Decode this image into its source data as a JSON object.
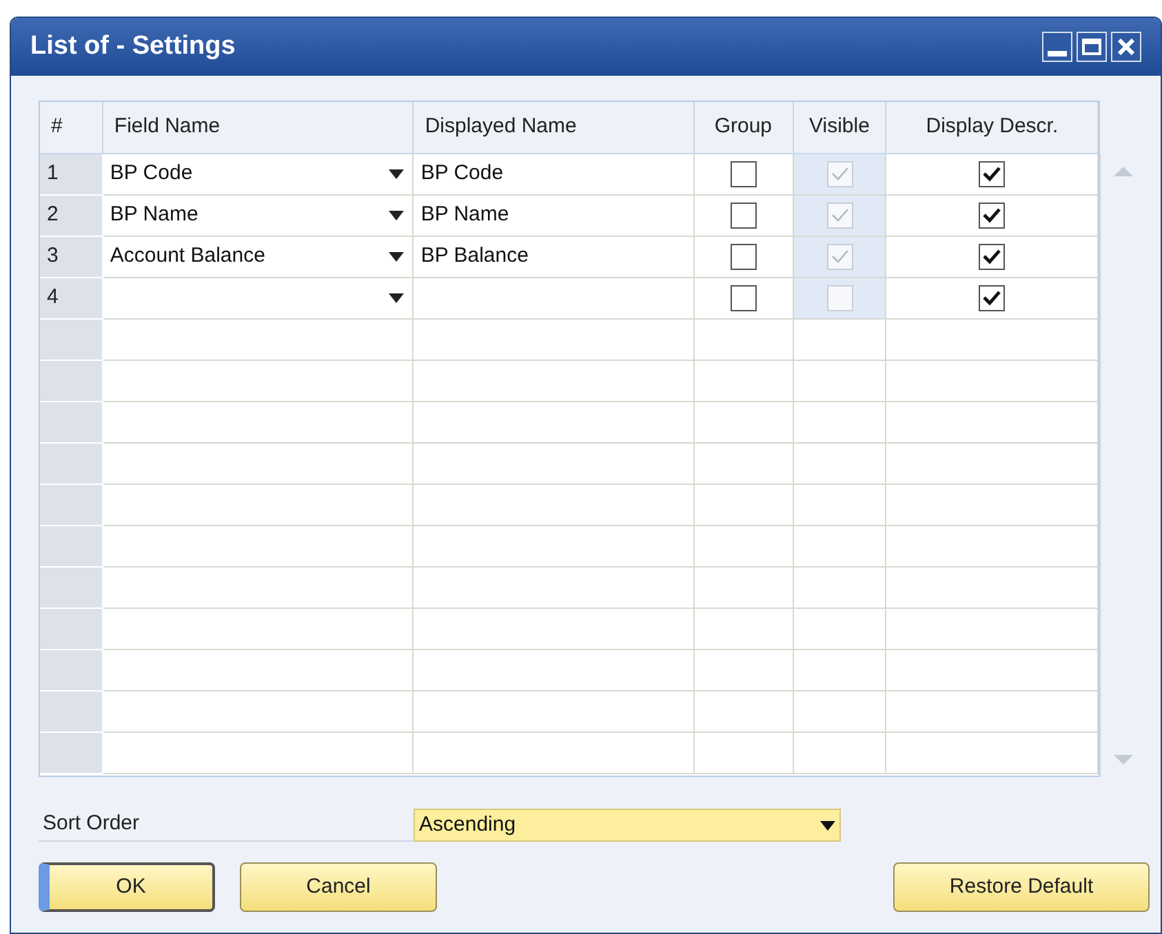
{
  "window": {
    "title": "List of - Settings"
  },
  "table": {
    "columns": [
      "#",
      "Field Name",
      "Displayed Name",
      "Group",
      "Visible",
      "Display Descr."
    ],
    "rows": [
      {
        "number": "1",
        "field_name": "BP Code",
        "displayed_name": "BP Code",
        "group": false,
        "visible": true,
        "visible_disabled": true,
        "display_descr": true
      },
      {
        "number": "2",
        "field_name": "BP Name",
        "displayed_name": "BP Name",
        "group": false,
        "visible": true,
        "visible_disabled": true,
        "display_descr": true
      },
      {
        "number": "3",
        "field_name": "Account Balance",
        "displayed_name": "BP Balance",
        "group": false,
        "visible": true,
        "visible_disabled": true,
        "display_descr": true
      },
      {
        "number": "4",
        "group": false,
        "visible": false,
        "visible_disabled": true,
        "display_descr": true
      }
    ]
  },
  "sort_order": {
    "label": "Sort Order",
    "value": "Ascending"
  },
  "buttons": [
    {
      "label": "OK",
      "default": true
    },
    {
      "label": "Cancel",
      "default": false
    },
    {
      "label": "Restore Default",
      "default": false
    }
  ]
}
